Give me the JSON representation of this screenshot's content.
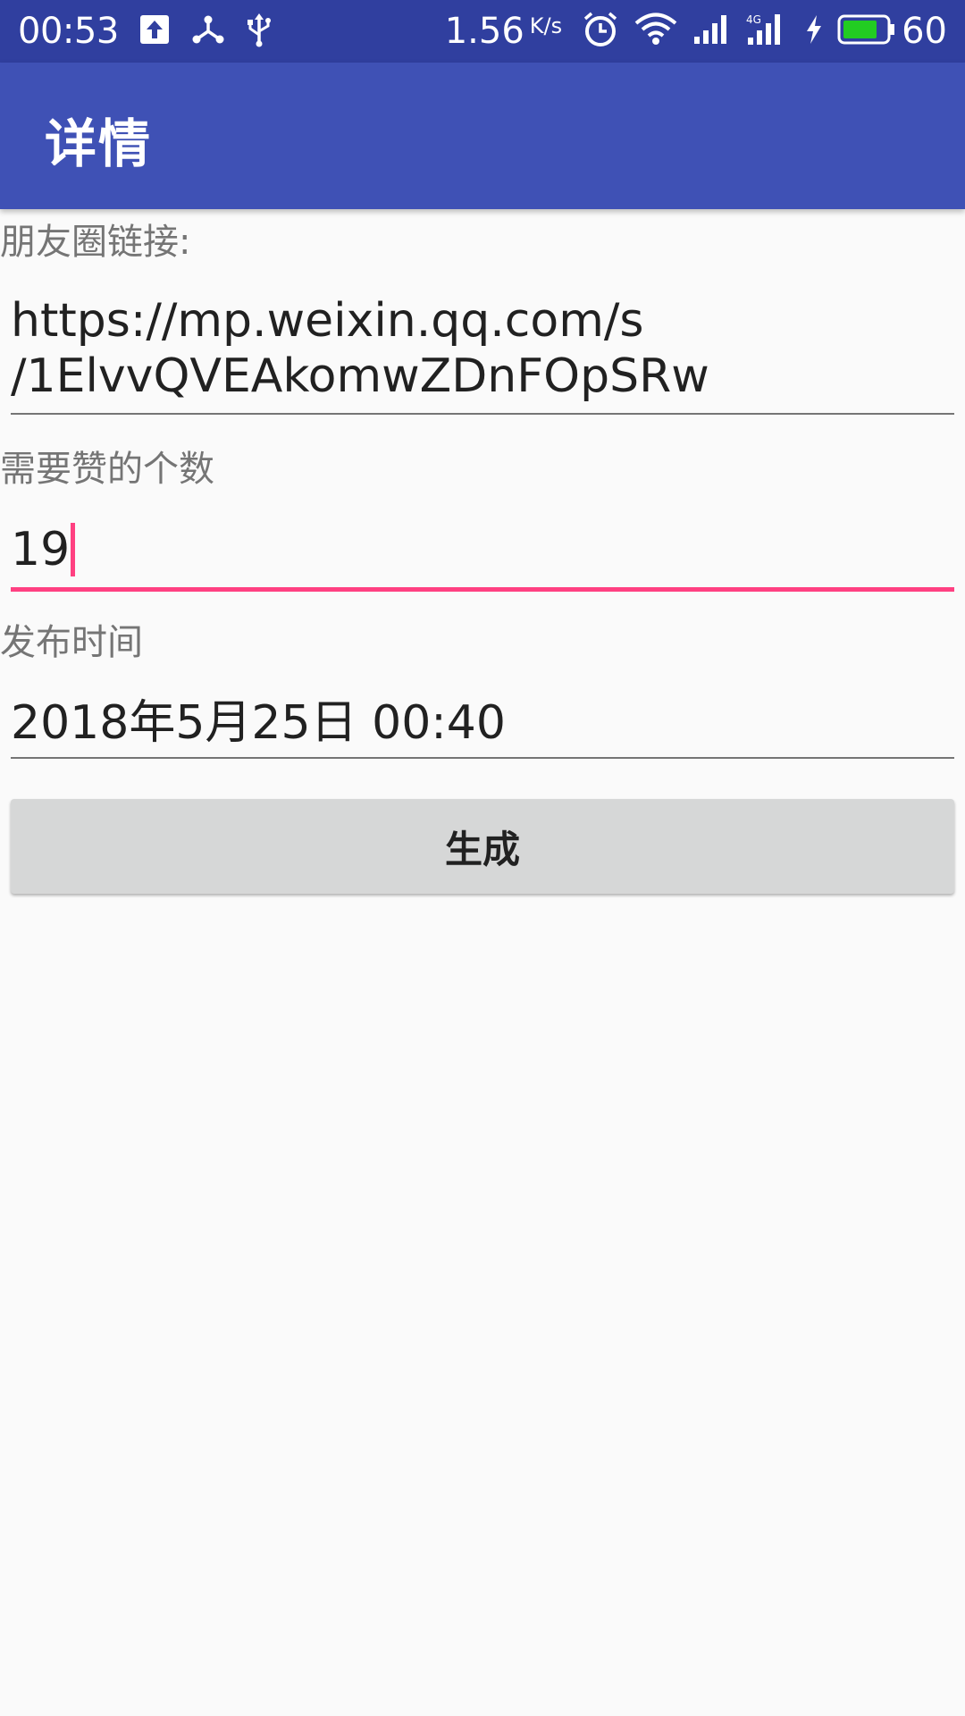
{
  "status_bar": {
    "time": "00:53",
    "net_speed": "1.56",
    "net_speed_unit": "K/s",
    "battery_level": "60",
    "battery_color": "#22cc22"
  },
  "app_bar": {
    "title": "详情",
    "color": "#3f51b5"
  },
  "form": {
    "link_label": "朋友圈链接:",
    "link_value_line1": "https://mp.weixin.qq.com/s",
    "link_value_line2": "/1ElvvQVEAkomwZDnFOpSRw",
    "likes_label": "需要赞的个数",
    "likes_value": "19",
    "time_label": "发布时间",
    "time_value": "2018年5月25日 00:40",
    "accent_color": "#ff4081"
  },
  "actions": {
    "generate_label": "生成"
  }
}
